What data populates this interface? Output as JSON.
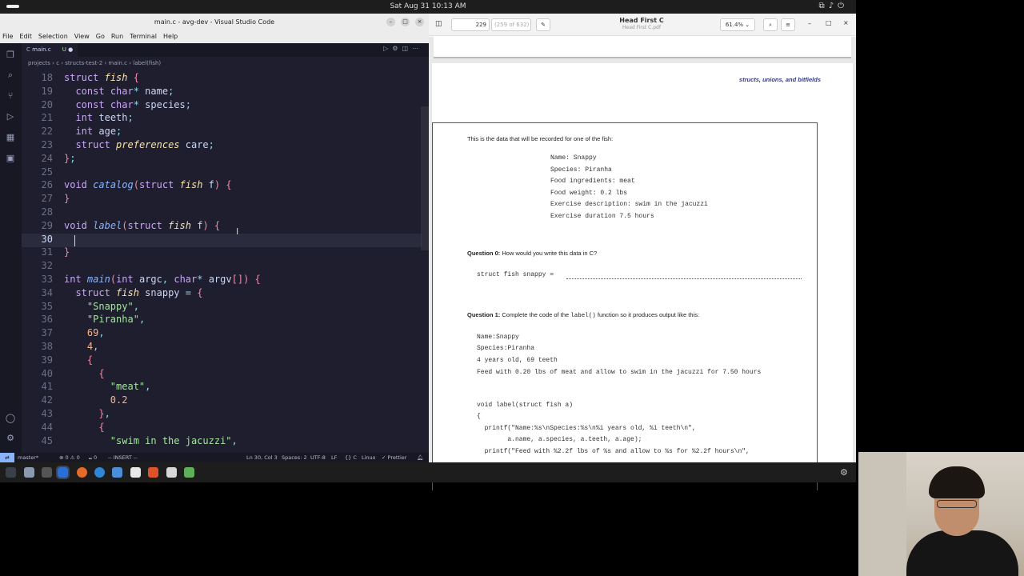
{
  "topbar": {
    "datetime": "Sat Aug 31  10:13 AM"
  },
  "vscode": {
    "title": "main.c - avg-dev - Visual Studio Code",
    "menu": [
      "File",
      "Edit",
      "Selection",
      "View",
      "Go",
      "Run",
      "Terminal",
      "Help"
    ],
    "tab": {
      "name": "main.c",
      "status": "U"
    },
    "breadcrumb": "projects  ›  c  ›  structs-test-2  ›  main.c  ›  label(fish)",
    "code": [
      {
        "n": "18",
        "t": "struct fish {"
      },
      {
        "n": "19",
        "t": "  const char* name;"
      },
      {
        "n": "20",
        "t": "  const char* species;"
      },
      {
        "n": "21",
        "t": "  int teeth;"
      },
      {
        "n": "22",
        "t": "  int age;"
      },
      {
        "n": "23",
        "t": "  struct preferences care;"
      },
      {
        "n": "24",
        "t": "};"
      },
      {
        "n": "25",
        "t": ""
      },
      {
        "n": "26",
        "t": "void catalog(struct fish f) {"
      },
      {
        "n": "27",
        "t": "}"
      },
      {
        "n": "28",
        "t": ""
      },
      {
        "n": "29",
        "t": "void label(struct fish f) {"
      },
      {
        "n": "30",
        "t": ""
      },
      {
        "n": "31",
        "t": "}"
      },
      {
        "n": "32",
        "t": ""
      },
      {
        "n": "33",
        "t": "int main(int argc, char* argv[]) {"
      },
      {
        "n": "34",
        "t": "  struct fish snappy = {"
      },
      {
        "n": "35",
        "t": "    \"Snappy\","
      },
      {
        "n": "36",
        "t": "    \"Piranha\","
      },
      {
        "n": "37",
        "t": "    69,"
      },
      {
        "n": "38",
        "t": "    4,"
      },
      {
        "n": "39",
        "t": "    {"
      },
      {
        "n": "40",
        "t": "      {"
      },
      {
        "n": "41",
        "t": "        \"meat\","
      },
      {
        "n": "42",
        "t": "        0.2"
      },
      {
        "n": "43",
        "t": "      },"
      },
      {
        "n": "44",
        "t": "      {"
      },
      {
        "n": "45",
        "t": "        \"swim in the jacuzzi\","
      }
    ],
    "status": {
      "branch": "master*",
      "problems": "⊗ 0 ⚠ 0",
      "ports": "⑉ 0",
      "mode": "-- INSERT --",
      "position": "Ln 30, Col 3",
      "spaces": "Spaces: 2",
      "encoding": "UTF-8",
      "eol": "LF",
      "language": "{} C",
      "os": "Linux",
      "formatter": "✓ Prettier"
    }
  },
  "pdf": {
    "title": "Head First C",
    "subtitle": "Head First C.pdf",
    "page": "229",
    "page_total": "(259 of 632)",
    "zoom": "61.4%",
    "header": "structs, unions, and bitfields",
    "intro": "This is the data that will be recorded for one of the fish:",
    "data_lines": [
      "Name: Snappy",
      "Species: Piranha",
      "Food ingredients: meat",
      "Food weight: 0.2 lbs",
      "Exercise description: swim in the jacuzzi",
      "Exercise duration 7.5 hours"
    ],
    "q0_label": "Question 0:",
    "q0_text": "How would you write this data in C?",
    "q0_code": "struct fish snappy =",
    "q1_label": "Question 1:",
    "q1_text_a": "Complete the code of the",
    "q1_fn": "label()",
    "q1_text_b": "function so it produces output like this:",
    "output_lines": [
      "Name:Snappy",
      "Species:Piranha",
      "4 years old, 69 teeth",
      "Feed with 0.20 lbs of meat and allow to swim in the jacuzzi for 7.50 hours"
    ],
    "code_lines": [
      "void label(struct fish a)",
      "{",
      "  printf(\"Name:%s\\nSpecies:%s\\n%i years old, %i teeth\\n\",",
      "        a.name, a.species, a.teeth, a.age);",
      "  printf(\"Feed with %2.2f lbs of %s and allow to %s for %2.2f hours\\n\","
    ]
  }
}
